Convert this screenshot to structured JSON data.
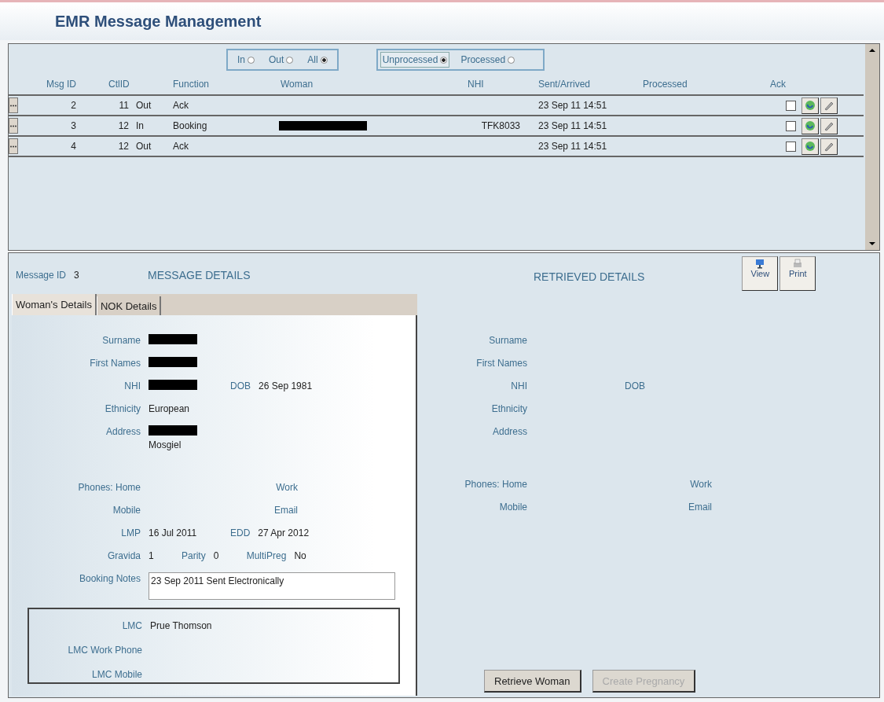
{
  "title": "EMR Message Management",
  "direction_filter": [
    {
      "label": "In",
      "selected": false
    },
    {
      "label": "Out",
      "selected": false
    },
    {
      "label": "All",
      "selected": true
    }
  ],
  "status_filter": [
    {
      "label": "Unprocessed",
      "selected": true
    },
    {
      "label": "Processed",
      "selected": false
    }
  ],
  "table": {
    "columns": [
      "Msg ID",
      "CtlID",
      "Function",
      "Woman",
      "NHI",
      "Sent/Arrived",
      "Processed",
      "Ack"
    ],
    "rows": [
      {
        "msg_id": "2",
        "ctl_id": "11",
        "direction": "Out",
        "function": "Ack",
        "sent": "23 Sep 11 14:51",
        "ack": false
      },
      {
        "msg_id": "3",
        "ctl_id": "12",
        "direction": "In",
        "function": "Booking",
        "woman_redacted": true,
        "nhi": "TFK8033",
        "sent": "23 Sep 11 14:51",
        "ack": false
      },
      {
        "msg_id": "4",
        "ctl_id": "12",
        "direction": "Out",
        "function": "Ack",
        "sent": "23 Sep 11 14:51",
        "ack": false
      }
    ]
  },
  "message": {
    "id_label": "Message ID",
    "id": "3",
    "heading": "MESSAGE DETAILS"
  },
  "retrieved_heading": "RETRIEVED DETAILS",
  "tool_buttons": [
    {
      "label": "View",
      "kind": "view"
    },
    {
      "label": "Print",
      "kind": "print"
    }
  ],
  "tabs": [
    {
      "label": "Woman's Details",
      "selected": true
    },
    {
      "label": "NOK Details",
      "selected": false
    }
  ],
  "womans_details": {
    "rows": [
      {
        "kind": "field",
        "label": "Surname",
        "redacted": true
      },
      {
        "kind": "field",
        "label": "First Names",
        "redacted": true
      },
      {
        "kind": "field",
        "label": "NHI",
        "redacted": true,
        "extras": [
          {
            "label": "DOB",
            "value": "26 Sep 1981"
          }
        ]
      },
      {
        "kind": "field",
        "label": "Ethnicity",
        "value": "European"
      },
      {
        "kind": "field",
        "label": "Address",
        "redacted": true,
        "line2": "Mosgiel"
      },
      {
        "kind": "gap"
      },
      {
        "kind": "phone",
        "label": "Phones: Home",
        "extras": [
          {
            "label": "Work"
          }
        ]
      },
      {
        "kind": "phone",
        "label": "Mobile",
        "extras": [
          {
            "label": "Email"
          }
        ]
      },
      {
        "kind": "field",
        "label": "LMP",
        "value": "16 Jul 2011",
        "extras": [
          {
            "label": "EDD",
            "value": "27 Apr 2012"
          }
        ]
      },
      {
        "kind": "compact",
        "label": "Gravida",
        "value": "1",
        "extras": [
          {
            "label": "Parity",
            "value": "0"
          },
          {
            "label": "MultiPreg",
            "value": "No"
          }
        ]
      },
      {
        "kind": "notes",
        "label": "Booking Notes",
        "value": "23 Sep 2011 Sent Electronically"
      }
    ],
    "lmc": [
      {
        "label": "LMC",
        "value": "Prue Thomson"
      },
      {
        "label": "LMC Work Phone"
      },
      {
        "label": "LMC Mobile"
      }
    ]
  },
  "retrieved_details": {
    "rows": [
      {
        "kind": "field",
        "label": "Surname"
      },
      {
        "kind": "field",
        "label": "First Names"
      },
      {
        "kind": "field",
        "label": "NHI",
        "extras": [
          {
            "label": "DOB"
          }
        ]
      },
      {
        "kind": "field",
        "label": "Ethnicity"
      },
      {
        "kind": "field",
        "label": "Address"
      },
      {
        "kind": "gap"
      },
      {
        "kind": "phone",
        "label": "Phones: Home",
        "extras": [
          {
            "label": "Work"
          }
        ]
      },
      {
        "kind": "phone",
        "label": "Mobile",
        "extras": [
          {
            "label": "Email"
          }
        ]
      }
    ]
  },
  "actions": [
    {
      "label": "Retrieve Woman",
      "disabled": false
    },
    {
      "label": "Create Pregnancy",
      "disabled": true
    }
  ]
}
